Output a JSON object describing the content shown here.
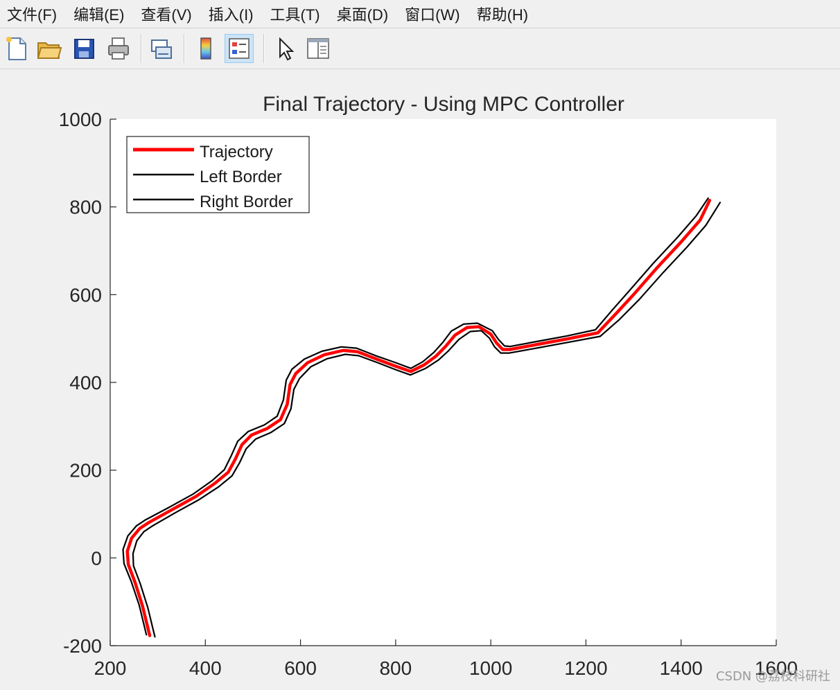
{
  "menubar": {
    "items": [
      "文件(F)",
      "编辑(E)",
      "查看(V)",
      "插入(I)",
      "工具(T)",
      "桌面(D)",
      "窗口(W)",
      "帮助(H)"
    ]
  },
  "toolbar": {
    "buttons": [
      "new-figure-icon",
      "open-file-icon",
      "save-icon",
      "print-icon",
      "link-plot-icon",
      "colorbar-icon",
      "legend-icon",
      "edit-plot-icon",
      "property-inspector-icon"
    ],
    "active": "legend-icon"
  },
  "colors": {
    "trajectory": "#ff0000",
    "border": "#000000",
    "axis": "#262626"
  },
  "chart_data": {
    "type": "line",
    "title": "Final Trajectory - Using MPC Controller",
    "xlabel": "",
    "ylabel": "",
    "xlim": [
      200,
      1600
    ],
    "ylim": [
      -200,
      1000
    ],
    "xticks": [
      200,
      400,
      600,
      800,
      1000,
      1200,
      1400,
      1600
    ],
    "yticks": [
      -200,
      0,
      200,
      400,
      600,
      800,
      1000
    ],
    "grid": false,
    "legend": {
      "placement": "top-left",
      "entries": [
        "Trajectory",
        "Left Border",
        "Right Border"
      ]
    },
    "series": [
      {
        "name": "Trajectory",
        "color": "#ff0000",
        "x": [
          283,
          268,
          252,
          238,
          236,
          245,
          262,
          280,
          330,
          380,
          420,
          448,
          463,
          477,
          497,
          530,
          558,
          572,
          578,
          590,
          615,
          650,
          690,
          720,
          760,
          800,
          832,
          860,
          885,
          905,
          925,
          950,
          975,
          1000,
          1012,
          1025,
          1040,
          1100,
          1160,
          1225,
          1260,
          1300,
          1350,
          1400,
          1440,
          1460
        ],
        "y": [
          -177,
          -110,
          -55,
          -15,
          15,
          45,
          67,
          80,
          110,
          140,
          170,
          195,
          225,
          258,
          280,
          295,
          315,
          350,
          395,
          420,
          445,
          463,
          473,
          470,
          453,
          437,
          425,
          440,
          460,
          482,
          508,
          525,
          527,
          510,
          490,
          475,
          475,
          487,
          499,
          513,
          553,
          600,
          662,
          720,
          770,
          815
        ]
      },
      {
        "name": "Left Border",
        "color": "#000000",
        "x": [
          276,
          261,
          244,
          229,
          227,
          237,
          255,
          273,
          325,
          375,
          414,
          440,
          454,
          468,
          490,
          524,
          551,
          564,
          570,
          582,
          608,
          645,
          686,
          718,
          758,
          800,
          832,
          857,
          880,
          899,
          917,
          943,
          972,
          1003,
          1016,
          1029,
          1041,
          1100,
          1160,
          1220,
          1253,
          1292,
          1342,
          1392,
          1432,
          1457
        ],
        "y": [
          -175,
          -108,
          -53,
          -13,
          19,
          50,
          73,
          86,
          116,
          146,
          176,
          201,
          232,
          266,
          288,
          303,
          323,
          360,
          405,
          430,
          453,
          471,
          481,
          478,
          461,
          445,
          432,
          447,
          468,
          491,
          517,
          533,
          535,
          518,
          498,
          483,
          482,
          494,
          506,
          520,
          562,
          610,
          672,
          730,
          780,
          820
        ]
      },
      {
        "name": "Right Border",
        "color": "#000000",
        "x": [
          294,
          279,
          263,
          249,
          248,
          256,
          271,
          289,
          337,
          387,
          428,
          456,
          472,
          486,
          506,
          538,
          566,
          580,
          586,
          598,
          622,
          656,
          694,
          722,
          762,
          800,
          831,
          863,
          890,
          911,
          933,
          957,
          980,
          997,
          1008,
          1021,
          1039,
          1100,
          1160,
          1230,
          1270,
          1312,
          1362,
          1412,
          1452,
          1482
        ],
        "y": [
          -180,
          -113,
          -58,
          -18,
          10,
          39,
          60,
          73,
          103,
          133,
          162,
          187,
          217,
          249,
          271,
          286,
          306,
          340,
          384,
          409,
          436,
          454,
          464,
          461,
          445,
          429,
          417,
          432,
          451,
          472,
          498,
          516,
          518,
          501,
          481,
          467,
          467,
          479,
          491,
          505,
          543,
          589,
          650,
          708,
          758,
          810
        ]
      }
    ]
  },
  "watermark": "CSDN @荔枝科研社"
}
